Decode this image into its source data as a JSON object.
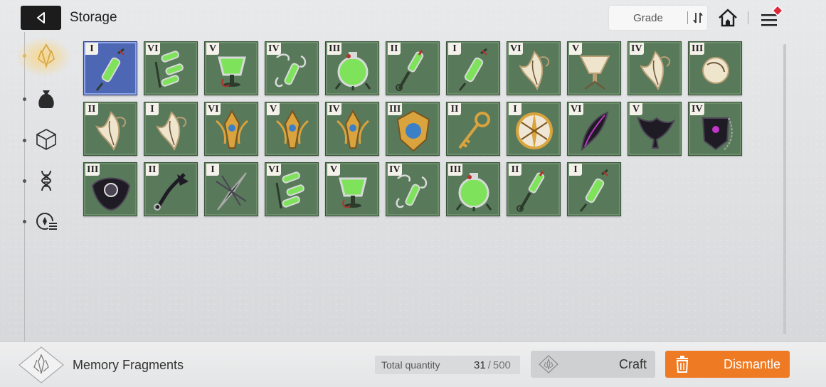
{
  "header": {
    "title": "Storage",
    "sort_label": "Grade"
  },
  "nav": {
    "items": [
      {
        "icon": "memory-fragment-icon",
        "active": true
      },
      {
        "icon": "pouch-icon",
        "active": false
      },
      {
        "icon": "cube-icon",
        "active": false
      },
      {
        "icon": "dna-icon",
        "active": false
      },
      {
        "icon": "module-list-icon",
        "active": false
      }
    ]
  },
  "items": [
    {
      "grade": "I",
      "icon": "syringe-vial-icon",
      "selected": true
    },
    {
      "grade": "VI",
      "icon": "triple-vials-icon"
    },
    {
      "grade": "V",
      "icon": "flask-goblet-icon"
    },
    {
      "grade": "IV",
      "icon": "chained-vial-icon"
    },
    {
      "grade": "III",
      "icon": "round-flask-icon"
    },
    {
      "grade": "II",
      "icon": "key-vial-icon"
    },
    {
      "grade": "I",
      "icon": "syringe-vial-icon"
    },
    {
      "grade": "VI",
      "icon": "bone-feathers-icon"
    },
    {
      "grade": "V",
      "icon": "bone-goblet-icon"
    },
    {
      "grade": "IV",
      "icon": "bone-pendant-icon"
    },
    {
      "grade": "III",
      "icon": "bone-orb-icon"
    },
    {
      "grade": "II",
      "icon": "bone-mask-icon"
    },
    {
      "grade": "I",
      "icon": "bone-blade-icon"
    },
    {
      "grade": "VI",
      "icon": "golden-wings-icon"
    },
    {
      "grade": "V",
      "icon": "golden-lantern-icon"
    },
    {
      "grade": "IV",
      "icon": "golden-trident-icon"
    },
    {
      "grade": "III",
      "icon": "golden-shield-icon"
    },
    {
      "grade": "II",
      "icon": "golden-key-icon"
    },
    {
      "grade": "I",
      "icon": "golden-emblem-icon"
    },
    {
      "grade": "VI",
      "icon": "dark-feathers-icon"
    },
    {
      "grade": "V",
      "icon": "dark-bird-icon"
    },
    {
      "grade": "IV",
      "icon": "dark-pendant-icon"
    },
    {
      "grade": "III",
      "icon": "dark-orb-icon"
    },
    {
      "grade": "II",
      "icon": "dark-key-icon"
    },
    {
      "grade": "I",
      "icon": "dark-blade-icon"
    },
    {
      "grade": "VI",
      "icon": "triple-vials-icon"
    },
    {
      "grade": "V",
      "icon": "flask-goblet-icon"
    },
    {
      "grade": "IV",
      "icon": "chained-vial-icon"
    },
    {
      "grade": "III",
      "icon": "round-flask-icon"
    },
    {
      "grade": "II",
      "icon": "key-vial-icon"
    },
    {
      "grade": "I",
      "icon": "syringe-vial-icon"
    }
  ],
  "footer": {
    "category_label": "Memory Fragments",
    "total_label": "Total quantity",
    "total_current": "31",
    "total_separator": "/",
    "total_max": "500",
    "craft_label": "Craft",
    "dismantle_label": "Dismantle"
  },
  "colors": {
    "cell_bg": "#58795a",
    "selected_bg": "#4e67b5",
    "dismantle_orange": "#ee7a23",
    "notification_red": "#e0283c"
  }
}
